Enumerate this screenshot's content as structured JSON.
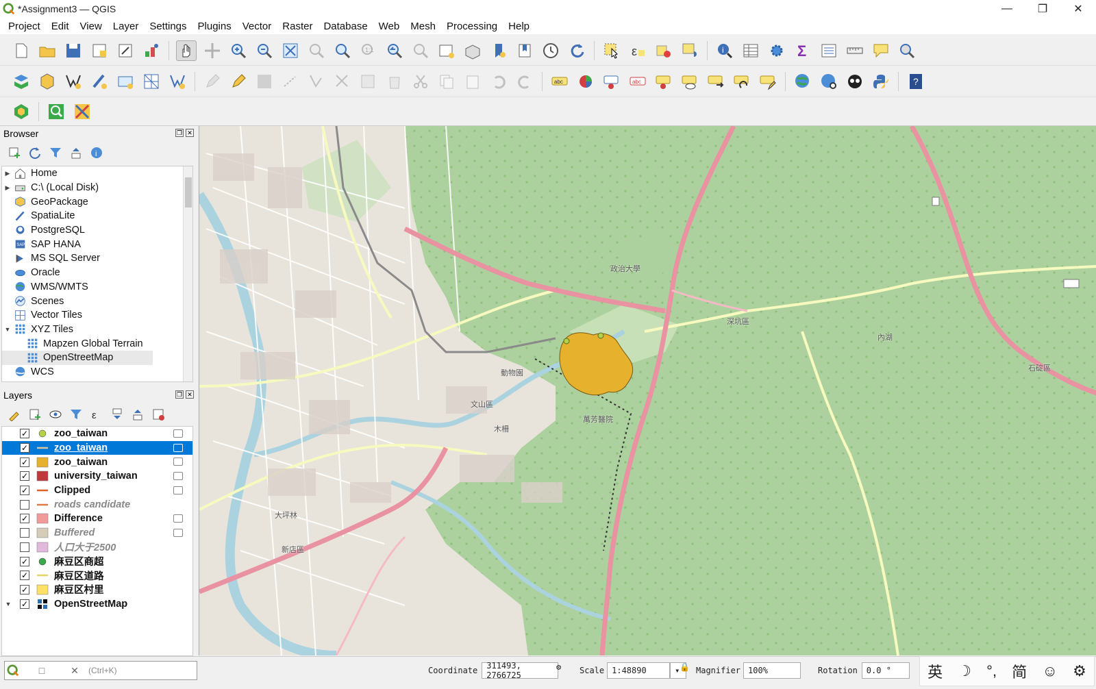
{
  "window": {
    "title": "*Assignment3 — QGIS",
    "minimize_icon": "minimize-icon",
    "maximize_icon": "maximize-icon",
    "close_icon": "close-icon"
  },
  "menu": [
    "Project",
    "Edit",
    "View",
    "Layer",
    "Settings",
    "Plugins",
    "Vector",
    "Raster",
    "Database",
    "Web",
    "Mesh",
    "Processing",
    "Help"
  ],
  "browser": {
    "title": "Browser",
    "items": [
      {
        "label": "Home",
        "icon": "home-icon",
        "expandable": true
      },
      {
        "label": "C:\\ (Local Disk)",
        "icon": "drive-icon",
        "expandable": true
      },
      {
        "label": "GeoPackage",
        "icon": "geopackage-icon",
        "expandable": false
      },
      {
        "label": "SpatiaLite",
        "icon": "spatialite-icon",
        "expandable": false
      },
      {
        "label": "PostgreSQL",
        "icon": "postgresql-icon",
        "expandable": false
      },
      {
        "label": "SAP HANA",
        "icon": "sap-hana-icon",
        "expandable": false
      },
      {
        "label": "MS SQL Server",
        "icon": "mssql-icon",
        "expandable": false
      },
      {
        "label": "Oracle",
        "icon": "oracle-icon",
        "expandable": false
      },
      {
        "label": "WMS/WMTS",
        "icon": "wms-icon",
        "expandable": false
      },
      {
        "label": "Scenes",
        "icon": "scenes-icon",
        "expandable": false
      },
      {
        "label": "Vector Tiles",
        "icon": "vector-tiles-icon",
        "expandable": false
      },
      {
        "label": "XYZ Tiles",
        "icon": "xyz-tiles-icon",
        "expandable": true,
        "expanded": true
      },
      {
        "label": "Mapzen Global Terrain",
        "icon": "xyz-tile-icon",
        "child": true
      },
      {
        "label": "OpenStreetMap",
        "icon": "xyz-tile-icon",
        "child": true,
        "selected": true
      },
      {
        "label": "WCS",
        "icon": "wcs-icon",
        "expandable": false
      }
    ]
  },
  "layers": {
    "title": "Layers",
    "items": [
      {
        "label": "zoo_taiwan",
        "checked": true,
        "symbol": "point",
        "color": "#b5d14a",
        "editable": true
      },
      {
        "label": "zoo_taiwan",
        "checked": true,
        "symbol": "line",
        "color": "#d8c6a0",
        "editable": true,
        "selected": true
      },
      {
        "label": "zoo_taiwan",
        "checked": true,
        "symbol": "fill",
        "color": "#e6b22e",
        "editable": true
      },
      {
        "label": "university_taiwan",
        "checked": true,
        "symbol": "fill",
        "color": "#c0393b",
        "editable": true
      },
      {
        "label": "Clipped",
        "checked": true,
        "symbol": "line",
        "color": "#e0602a",
        "editable": true
      },
      {
        "label": "roads candidate",
        "checked": false,
        "symbol": "line",
        "color": "#e07a40",
        "editable": false
      },
      {
        "label": "Difference",
        "checked": true,
        "symbol": "fill",
        "color": "#f29a9a",
        "editable": true
      },
      {
        "label": "Buffered",
        "checked": false,
        "symbol": "fill",
        "color": "#d6cdb8",
        "editable": true
      },
      {
        "label": "人口大于2500",
        "checked": false,
        "symbol": "fill",
        "color": "#e2b8dc",
        "editable": false
      },
      {
        "label": "麻豆区商超",
        "checked": true,
        "symbol": "point",
        "color": "#3ca94a",
        "editable": false
      },
      {
        "label": "麻豆区道路",
        "checked": true,
        "symbol": "line",
        "color": "#e3d46a",
        "editable": false
      },
      {
        "label": "麻豆区村里",
        "checked": true,
        "symbol": "fill",
        "color": "#ffe066",
        "editable": false
      },
      {
        "label": "OpenStreetMap",
        "checked": true,
        "symbol": "raster",
        "color": "#2a6fb0",
        "editable": false,
        "expandable": true
      }
    ]
  },
  "map": {
    "labels": [
      "文山區",
      "木柵",
      "新店區",
      "深坑區",
      "大坪林",
      "內湖",
      "石碇區",
      "動物園",
      "萬芳醫院",
      "政治大學"
    ],
    "zoo_polygon_color": "#e6b22e"
  },
  "locator": {
    "hint": "(Ctrl+K)"
  },
  "status": {
    "coordinate_label": "Coordinate",
    "coordinate_value": "311493,  2766725",
    "scale_label": "Scale",
    "scale_value": "1:48890",
    "magnifier_label": "Magnifier",
    "magnifier_value": "100%",
    "rotation_label": "Rotation",
    "rotation_value": "0.0 °"
  },
  "ime": [
    "英",
    "☽",
    "°,",
    "简",
    "☺",
    "⚙"
  ]
}
